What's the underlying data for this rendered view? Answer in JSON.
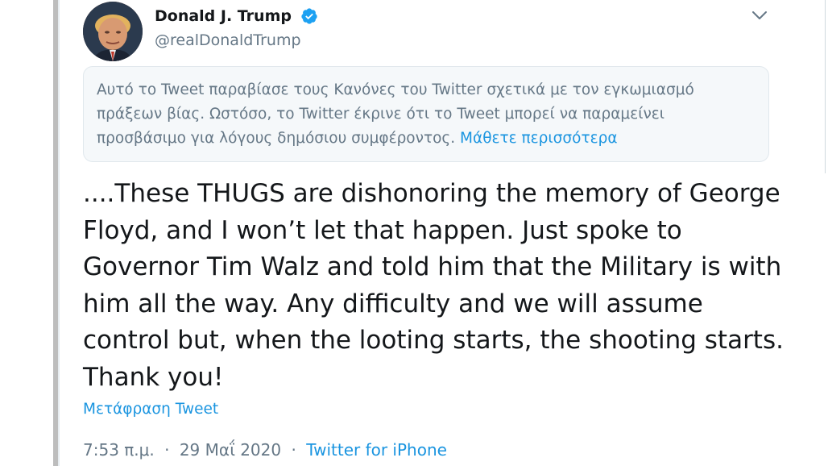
{
  "tweet": {
    "display_name": "Donald J. Trump",
    "handle": "@realDonaldTrump",
    "verified": true,
    "notice": {
      "text": "Αυτό το Tweet παραβίασε τους Κανόνες του Twitter σχετικά με τον εγκωμιασμό πράξεων βίας. Ωστόσο, το Twitter έκρινε ότι το Tweet μπορεί να παραμείνει προσβάσιμο για λόγους δημόσιου συμφέροντος.",
      "link_label": "Μάθετε περισσότερα"
    },
    "text": "....These THUGS are dishonoring the memory of George Floyd, and I won’t let that happen. Just spoke to Governor Tim Walz and told him that the Military is with him all the way. Any difficulty and we will assume control but, when the looting starts, the shooting starts. Thank you!",
    "translate_label": "Μετάφραση Tweet",
    "time": "7:53 π.μ.",
    "separator": "·",
    "date": "29 Μαΐ 2020",
    "source": "Twitter for iPhone"
  },
  "icons": {
    "verified": "verified-badge-icon",
    "caret": "chevron-down-icon"
  },
  "colors": {
    "link": "#1b95e0",
    "text": "#14171a",
    "secondary": "#657786",
    "notice_bg": "#f5f8fa"
  }
}
